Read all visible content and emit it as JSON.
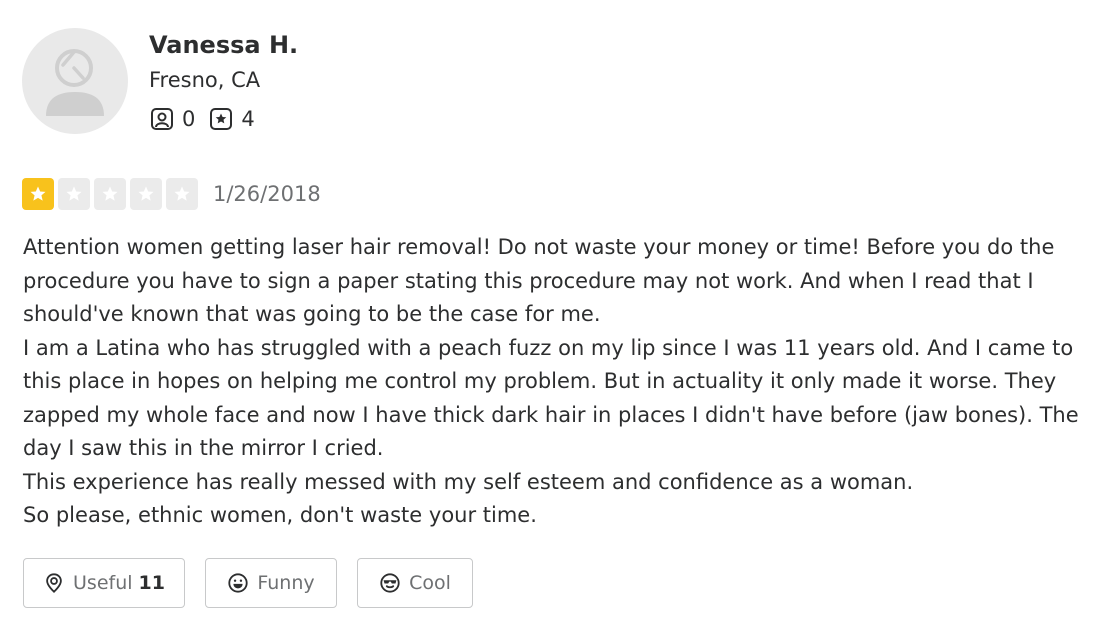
{
  "user": {
    "name": "Vanessa H.",
    "location": "Fresno, CA",
    "friends_count": "0",
    "reviews_count": "4",
    "avatar_icon": "default-user-icon",
    "friends_icon": "friends-icon",
    "reviews_icon": "star-review-icon"
  },
  "rating": {
    "value": 1,
    "max": 5,
    "date": "1/26/2018",
    "filled_color": "#f8c21c",
    "empty_color": "#ebebeb"
  },
  "review": {
    "lines": [
      "Attention women getting laser hair removal! Do not waste your money or time! Before you do the",
      "procedure you have to sign a paper stating this procedure may not work. And when I read that I",
      "should've known that was going to be the case for me.",
      "I am a Latina who has struggled with a peach fuzz on my lip since I was 11 years old. And I came to",
      "this place in hopes on helping me control my problem. But in actuality it only made it worse. They",
      "zapped my whole face and now I have thick dark hair in places I didn't have before (jaw bones). The",
      "day I saw this in the mirror I cried.",
      "This experience has really messed with my self esteem and confidence as a woman.",
      "So please, ethnic women, don't waste your time."
    ]
  },
  "reactions": {
    "useful": {
      "label": "Useful",
      "count": "11",
      "icon": "lightbulb-icon"
    },
    "funny": {
      "label": "Funny",
      "icon": "smile-icon"
    },
    "cool": {
      "label": "Cool",
      "icon": "sunglasses-face-icon"
    }
  }
}
